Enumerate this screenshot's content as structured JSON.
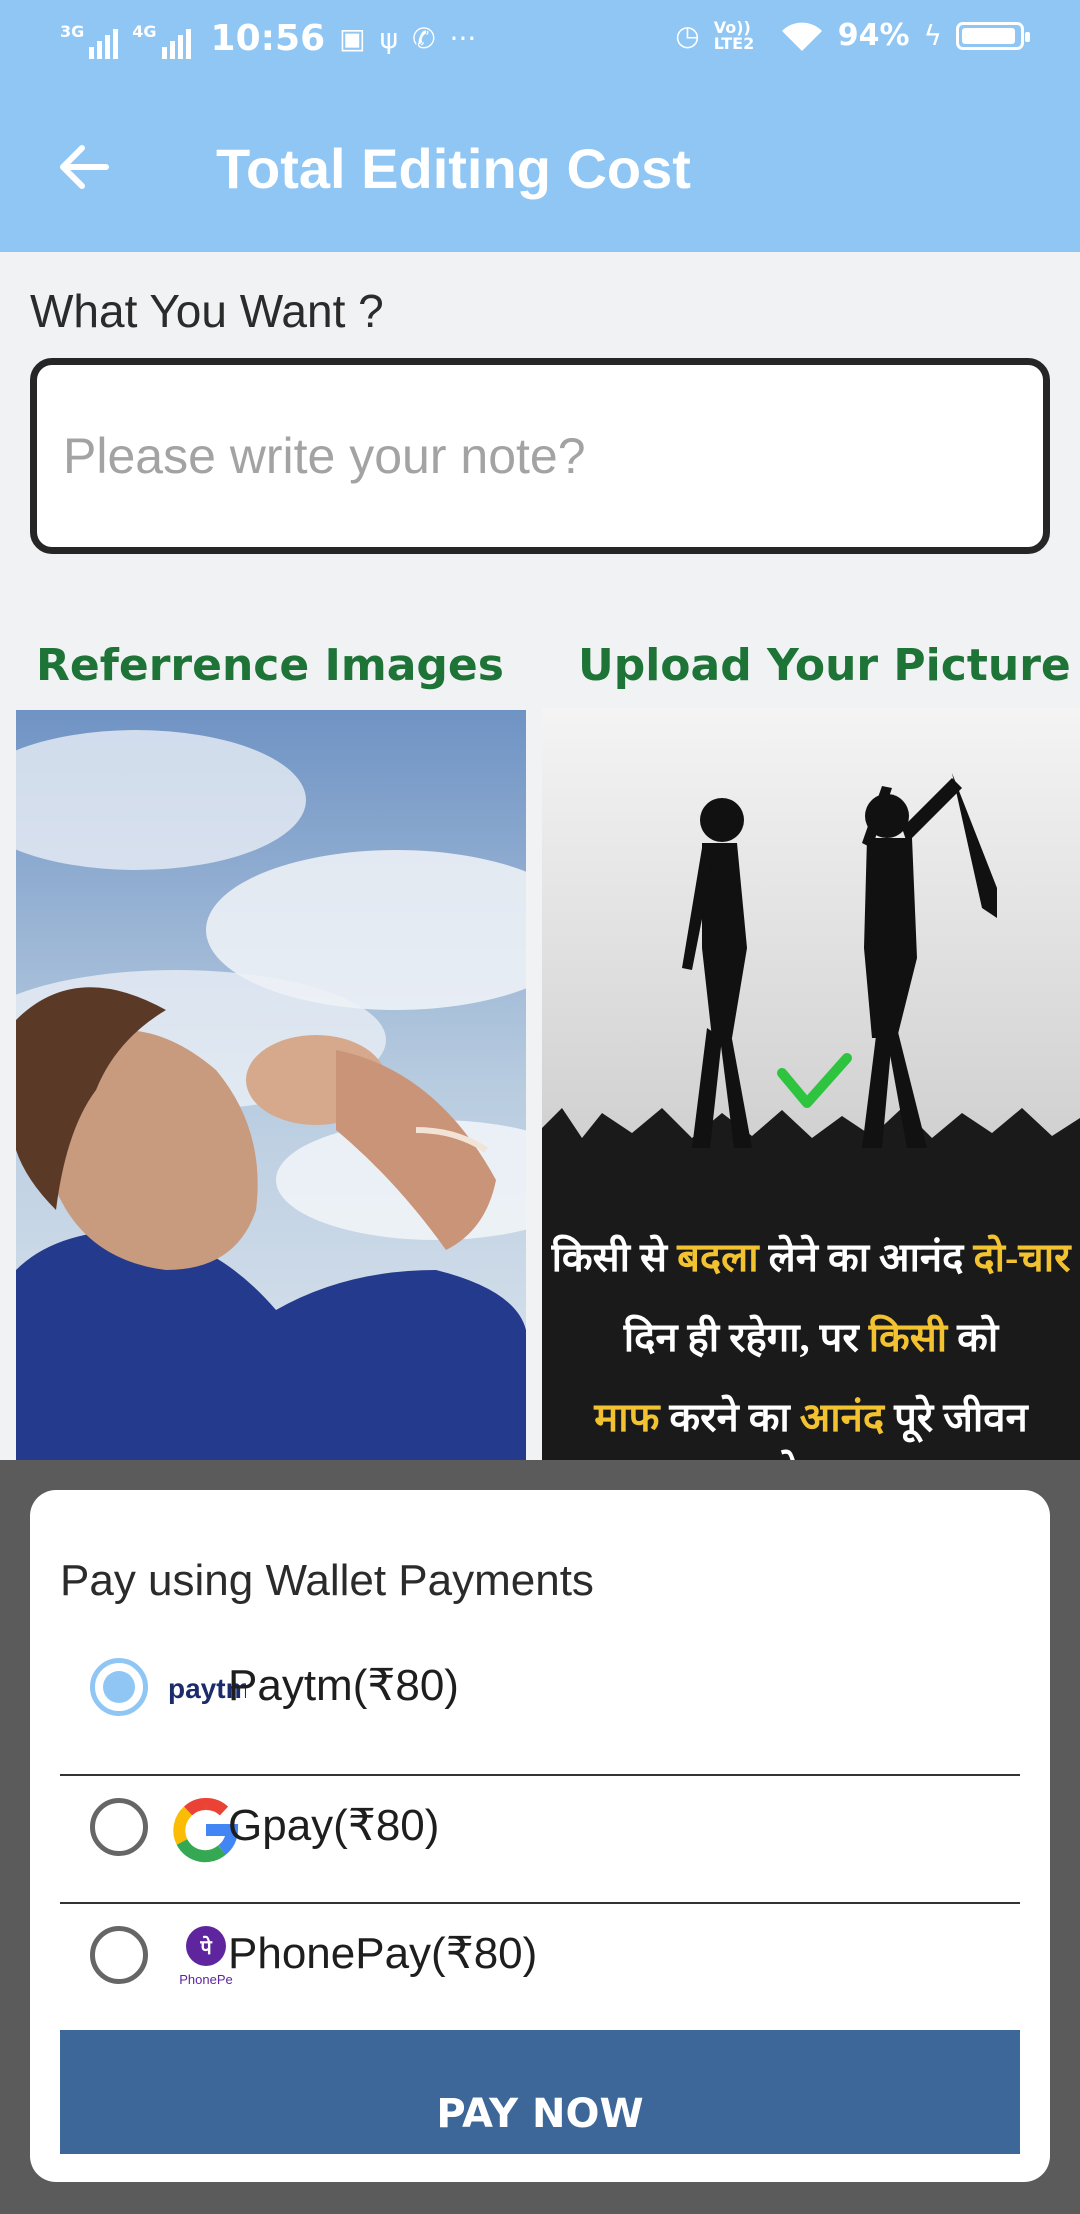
{
  "status_bar": {
    "net1": "3G",
    "net2": "4G",
    "time": "10:56",
    "lte": "Vo)) LTE2",
    "battery": "94%",
    "battery_level": 0.94
  },
  "app_bar": {
    "title": "Total Editing Cost",
    "back_icon": "arrow-left-icon"
  },
  "form": {
    "label": "What You Want ?",
    "note_placeholder": "Please write your note?",
    "note_value": ""
  },
  "sections": {
    "reference_title": "Referrence Images",
    "upload_title": "Upload Your Picture"
  },
  "upload_image": {
    "quote_line1_a": "किसी से ",
    "quote_line1_b": "बदला",
    "quote_line1_c": " लेने का आनंद ",
    "quote_line1_d": "दो-चार",
    "quote_line2_a": "दिन ही रहेगा, पर ",
    "quote_line2_b": "किसी",
    "quote_line2_c": " को",
    "quote_line3_a": "माफ",
    "quote_line3_b": " करने का ",
    "quote_line3_c": "आनंद",
    "quote_line3_d": " पूरे जीवन रहेगा..."
  },
  "payment_sheet": {
    "title": "Pay using Wallet Payments",
    "options": [
      {
        "label": "Paytm(₹80)",
        "logo": "paytm",
        "logo_text": "paytm",
        "selected": true
      },
      {
        "label": "Gpay(₹80)",
        "logo": "google",
        "selected": false
      },
      {
        "label": "PhonePay(₹80)",
        "logo": "phonepe",
        "logo_text": "PhonePe",
        "logo_glyph": "पे",
        "selected": false
      }
    ],
    "pay_button": "PAY NOW"
  },
  "colors": {
    "primary": "#8fc6f4",
    "section_title": "#1d7436",
    "pay_button": "#3d6699",
    "overlay": "#5b5b5b"
  }
}
